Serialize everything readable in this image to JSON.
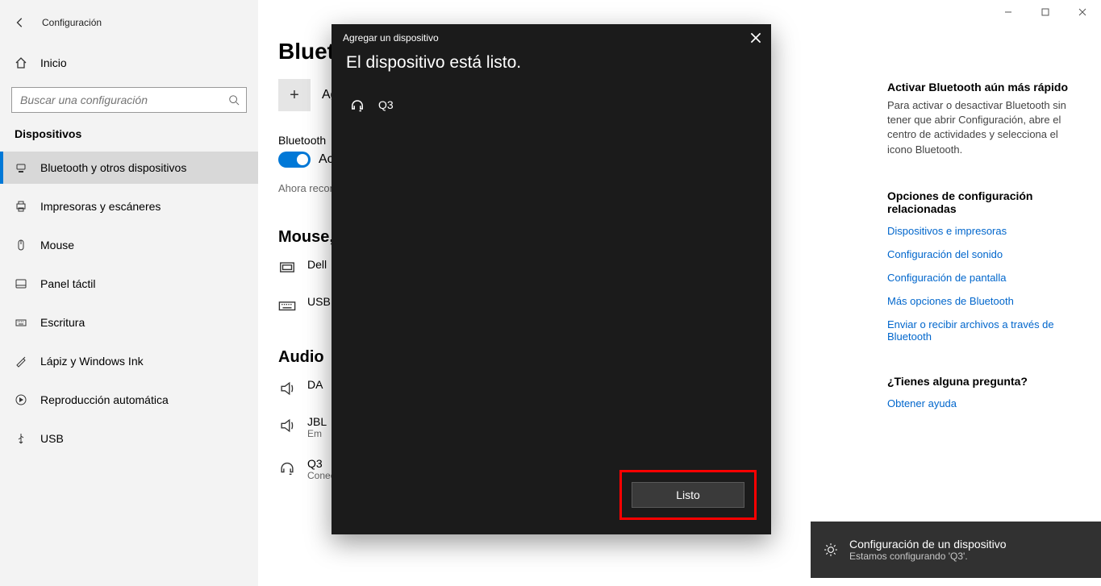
{
  "app": {
    "title": "Configuración"
  },
  "sidebar": {
    "home": "Inicio",
    "search_placeholder": "Buscar una configuración",
    "section": "Dispositivos",
    "items": [
      "Bluetooth y otros dispositivos",
      "Impresoras y escáneres",
      "Mouse",
      "Panel táctil",
      "Escritura",
      "Lápiz y Windows Ink",
      "Reproducción automática",
      "USB"
    ]
  },
  "main": {
    "heading": "Bluetooth y otros dispositivos",
    "add_label": "Agregar Bluetooth u otro dispositivo",
    "bt_label": "Bluetooth",
    "bt_state": "Activado",
    "discoverable": "Ahora reconocible como",
    "section_mouse": "Mouse, teclado y lápiz",
    "device_dell": "Dell",
    "device_usb": "USB",
    "section_audio": "Audio",
    "device_da": "DA",
    "device_jbl": "JBL",
    "device_jbl_sub": "Em",
    "device_q3": "Q3",
    "device_q3_sub": "Conectado"
  },
  "right": {
    "fast_title": "Activar Bluetooth aún más rápido",
    "fast_body": "Para activar o desactivar Bluetooth sin tener que abrir Configuración, abre el centro de actividades y selecciona el icono Bluetooth.",
    "related_title": "Opciones de configuración relacionadas",
    "links": [
      "Dispositivos e impresoras",
      "Configuración del sonido",
      "Configuración de pantalla",
      "Más opciones de Bluetooth",
      "Enviar o recibir archivos a través de Bluetooth"
    ],
    "question_title": "¿Tienes alguna pregunta?",
    "question_link": "Obtener ayuda"
  },
  "dialog": {
    "title": "Agregar un dispositivo",
    "heading": "El dispositivo está listo.",
    "device": "Q3",
    "done": "Listo"
  },
  "toast": {
    "title": "Configuración de un dispositivo",
    "sub": "Estamos configurando 'Q3'."
  }
}
